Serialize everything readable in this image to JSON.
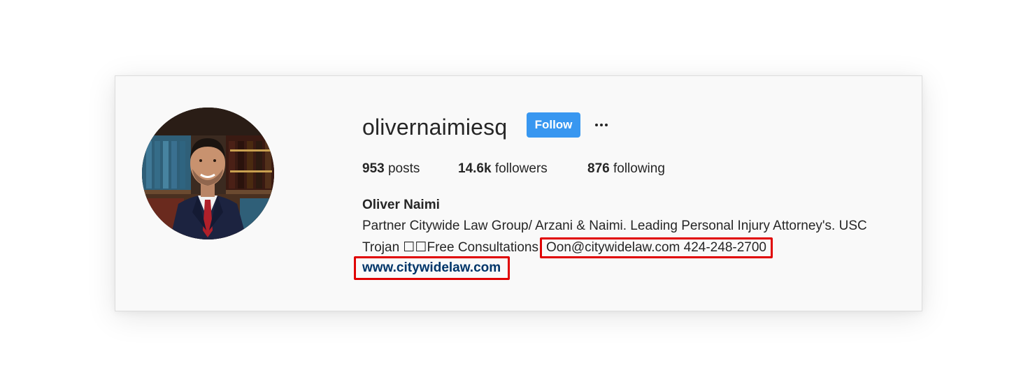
{
  "profile": {
    "username": "olivernaimiesq",
    "follow_label": "Follow",
    "more_icon": "ellipsis-icon",
    "stats": {
      "posts_count": "953",
      "posts_label": "posts",
      "followers_count": "14.6k",
      "followers_label": "followers",
      "following_count": "876",
      "following_label": "following"
    },
    "full_name": "Oliver Naimi",
    "bio_line1": "Partner Citywide Law Group/ Arzani & Naimi. Leading Personal Injury Attorney's. USC",
    "bio_line2_prefix": "Trojan ☐☐Free Consultations",
    "bio_contact": "Oon@citywidelaw.com 424-248-2700",
    "website": "www.citywidelaw.com"
  },
  "colors": {
    "follow_button": "#3897f0",
    "highlight_box": "#e00000",
    "link": "#003569"
  }
}
